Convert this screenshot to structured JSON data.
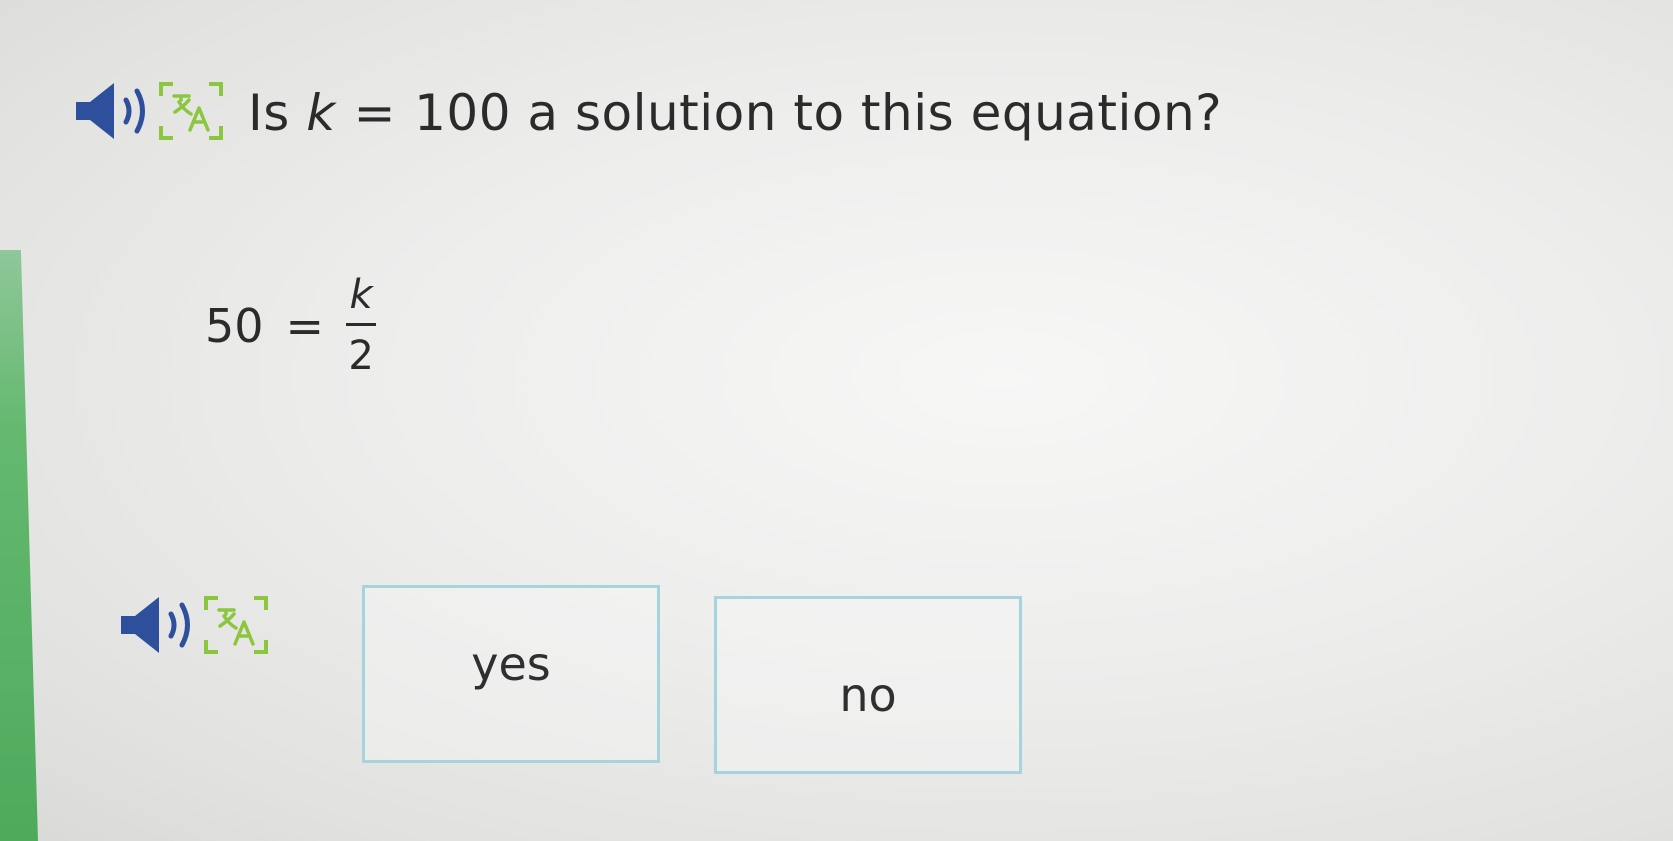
{
  "question": {
    "prefix": "Is",
    "variable": "k",
    "equals": "=",
    "value": "100",
    "suffix": "a solution to this equation?"
  },
  "equation": {
    "left": "50",
    "equals": "=",
    "numerator": "k",
    "denominator": "2"
  },
  "choices": {
    "yes": "yes",
    "no": "no"
  },
  "icons": {
    "audio": "speaker-icon",
    "translate": "translate-icon"
  },
  "colors": {
    "choice_border": "#a7d3de",
    "translate_icon": "#8cc63f",
    "accent_green": "#4faa5c"
  }
}
